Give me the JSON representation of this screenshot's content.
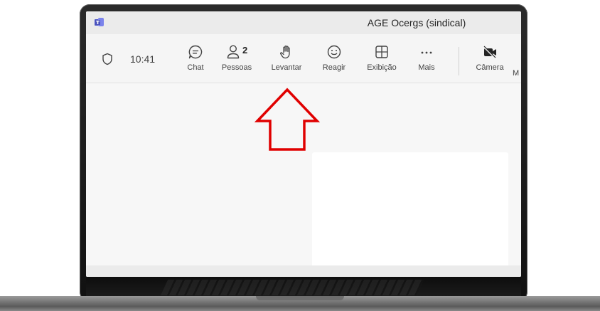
{
  "window": {
    "title": "AGE Ocergs (sindical)"
  },
  "toolbar": {
    "time": "10:41",
    "buttons": [
      {
        "key": "chat",
        "label": "Chat",
        "icon": "chat-icon"
      },
      {
        "key": "people",
        "label": "Pessoas",
        "icon": "people-icon",
        "count": "2"
      },
      {
        "key": "raise",
        "label": "Levantar",
        "icon": "raise-hand-icon"
      },
      {
        "key": "react",
        "label": "Reagir",
        "icon": "smiley-icon"
      },
      {
        "key": "view",
        "label": "Exibição",
        "icon": "grid-view-icon"
      },
      {
        "key": "more",
        "label": "Mais",
        "icon": "more-icon"
      },
      {
        "key": "camera",
        "label": "Câmera",
        "icon": "camera-off-icon"
      }
    ],
    "cut_label": "M"
  },
  "annotation": {
    "arrow_color": "#e00000",
    "points_to": "raise"
  },
  "colors": {
    "screen_bg": "#f3f3f3",
    "toolbar_bg": "#f5f5f5",
    "text": "#424242"
  }
}
